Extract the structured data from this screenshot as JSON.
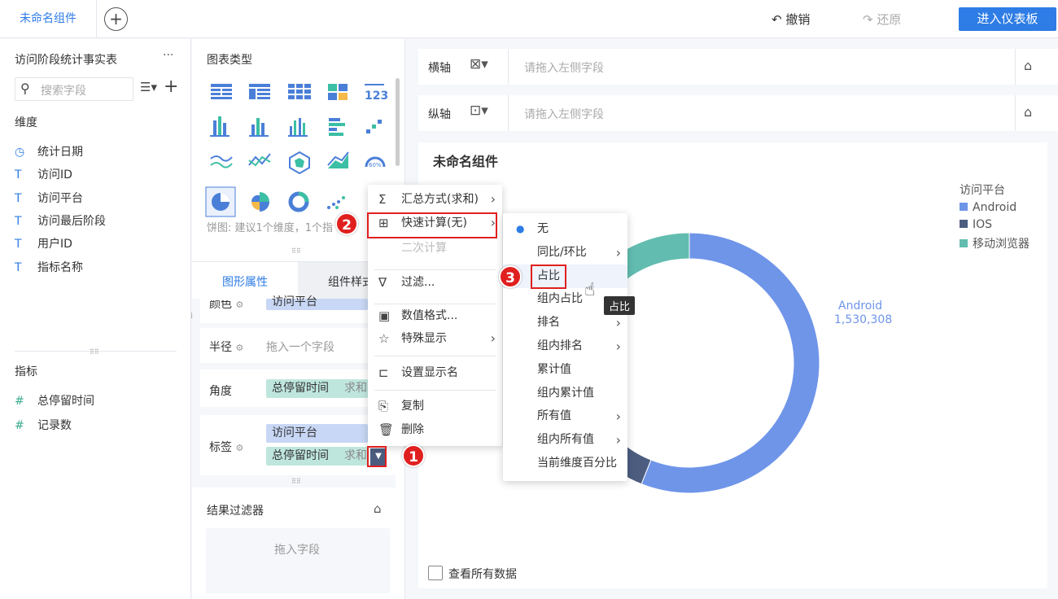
{
  "topbar": {
    "tab_label": "未命名组件",
    "add_icon": "plus-circle-icon",
    "undo_label": "撤销",
    "redo_label": "还原",
    "enter_label": "进入仪表板"
  },
  "left": {
    "dataset_title": "访问阶段统计事实表",
    "more": "···",
    "search_placeholder": "搜索字段",
    "dimension_header": "维度",
    "dimensions": [
      {
        "icon": "clock-icon",
        "glyph": "◷",
        "label": "统计日期"
      },
      {
        "icon": "text-icon",
        "glyph": "T",
        "label": "访问ID"
      },
      {
        "icon": "text-icon",
        "glyph": "T",
        "label": "访问平台"
      },
      {
        "icon": "text-icon",
        "glyph": "T",
        "label": "访问最后阶段"
      },
      {
        "icon": "text-icon",
        "glyph": "T",
        "label": "用户ID"
      },
      {
        "icon": "text-icon",
        "glyph": "T",
        "label": "指标名称"
      }
    ],
    "metric_header": "指标",
    "metrics": [
      {
        "icon": "number-icon",
        "glyph": "#",
        "label": "总停留时间"
      },
      {
        "icon": "number-icon",
        "glyph": "#",
        "label": "记录数"
      }
    ]
  },
  "mid": {
    "chart_type_title": "图表类型",
    "chart_hint": "饼图: 建议1个维度，1个指",
    "tabs": [
      "图形属性",
      "组件样式"
    ],
    "color_label": "颜色",
    "color_field": "访问平台",
    "radius_label": "半径",
    "radius_placeholder": "拖入一个字段",
    "angle_label": "角度",
    "angle_field": "总停留时间",
    "angle_agg": "求和",
    "tag_label": "标签",
    "tag_field1": "访问平台",
    "tag_field2": "总停留时间",
    "tag_agg": "求和",
    "result_filter": "结果过滤器",
    "drag_field": "拖入字段"
  },
  "axes": {
    "x_label": "横轴",
    "y_label": "纵轴",
    "placeholder": "请拖入左侧字段"
  },
  "chart": {
    "title": "未命名组件",
    "legend_title": "访问平台",
    "legend": [
      {
        "name": "Android",
        "color": "#6f95e9"
      },
      {
        "name": "IOS",
        "color": "#4c5d80"
      },
      {
        "name": "移动浏览器",
        "color": "#62bdb0"
      }
    ],
    "data_label_name": "Android",
    "data_label_value": "1,530,308",
    "view_all": "查看所有数据"
  },
  "chart_data": {
    "type": "pie",
    "categories": [
      "Android",
      "IOS",
      "移动浏览器"
    ],
    "values": [
      0.56,
      0.22,
      0.22
    ],
    "colors": [
      "#6f95e9",
      "#4c5d80",
      "#62bdb0"
    ]
  },
  "menu": {
    "items": [
      {
        "icon": "sum-icon",
        "glyph": "Σ",
        "label": "汇总方式(求和)",
        "arrow": true
      },
      {
        "icon": "quick-calc-icon",
        "glyph": "⊞",
        "label": "快速计算(无)",
        "arrow": true
      },
      {
        "icon": "",
        "glyph": "",
        "label": "二次计算",
        "arrow": false,
        "disabled": true
      },
      {
        "icon": "filter-icon",
        "glyph": "∇",
        "label": "过滤...",
        "arrow": false
      },
      {
        "icon": "number-format-icon",
        "glyph": "▣",
        "label": "数值格式...",
        "arrow": false
      },
      {
        "icon": "star-icon",
        "glyph": "☆",
        "label": "特殊显示",
        "arrow": true
      },
      {
        "icon": "rename-icon",
        "glyph": "⊏",
        "label": "设置显示名",
        "arrow": false
      },
      {
        "icon": "copy-icon",
        "glyph": "⎘",
        "label": "复制",
        "arrow": false
      },
      {
        "icon": "delete-icon",
        "glyph": "🗑",
        "label": "删除",
        "arrow": false
      }
    ]
  },
  "submenu": {
    "items": [
      {
        "label": "无",
        "arrow": false,
        "selected": true
      },
      {
        "label": "同比/环比",
        "arrow": true
      },
      {
        "label": "占比",
        "arrow": false
      },
      {
        "label": "组内占比",
        "arrow": false
      },
      {
        "label": "排名",
        "arrow": true
      },
      {
        "label": "组内排名",
        "arrow": true
      },
      {
        "label": "累计值",
        "arrow": false
      },
      {
        "label": "组内累计值",
        "arrow": false
      },
      {
        "label": "所有值",
        "arrow": true
      },
      {
        "label": "组内所有值",
        "arrow": true
      },
      {
        "label": "当前维度百分比",
        "arrow": false
      }
    ],
    "tooltip": "占比"
  },
  "badges": [
    "1",
    "2",
    "3"
  ]
}
